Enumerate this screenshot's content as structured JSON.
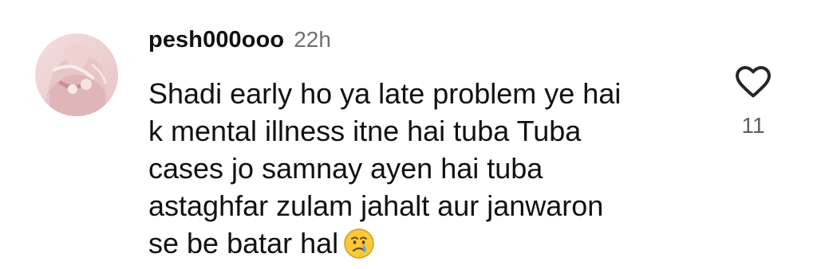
{
  "comment": {
    "username": "pesh000ooo",
    "timestamp": "22h",
    "text_lines": [
      "Shadi early ho ya late problem ye hai",
      "k mental illness itne hai tuba Tuba",
      "cases jo samnay ayen hai tuba",
      "astaghfar zulam jahalt aur janwaron",
      "se be batar hal"
    ],
    "emoji": "crying-face-icon",
    "likes": "11"
  },
  "icons": {
    "avatar": "avatar",
    "like": "heart-icon"
  },
  "colors": {
    "primary_text": "#111111",
    "secondary_text": "#6f6f6f",
    "icon_stroke": "#262626"
  }
}
